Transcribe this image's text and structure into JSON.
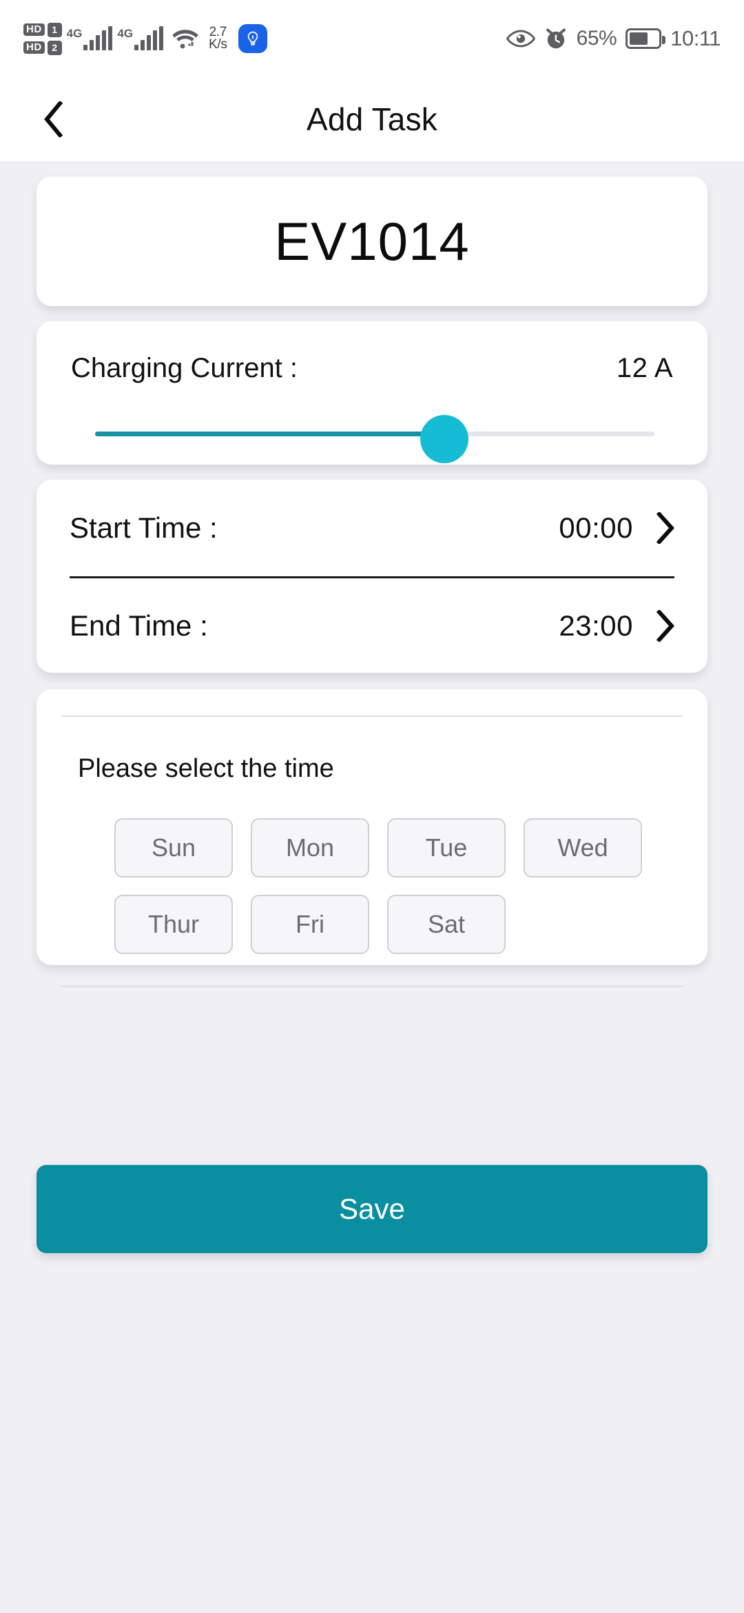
{
  "statusbar": {
    "hd1_label": "HD",
    "hd2_label": "HD",
    "sim1": "1",
    "sim2": "2",
    "net1": "4G",
    "net2": "4G",
    "speed_value": "2.7",
    "speed_unit": "K/s",
    "battery_percent": "65%",
    "clock": "10:11",
    "icons": {
      "wifi": "wifi-icon",
      "bulb_app": "lightbulb-app-icon",
      "eye": "eye-care-icon",
      "alarm": "alarm-clock-icon",
      "battery": "battery-icon"
    },
    "battery_fill_ratio": "65"
  },
  "appbar": {
    "title": "Add Task",
    "back_icon": "chevron-left-icon"
  },
  "device": {
    "name": "EV1014"
  },
  "charging": {
    "label": "Charging Current :",
    "value": "12 A",
    "slider": {
      "value": 12,
      "min": 6,
      "max": 32,
      "fill_percent": 57
    }
  },
  "times": [
    {
      "label": "Start Time :",
      "value": "00:00",
      "chevron": "chevron-right-icon"
    },
    {
      "label": "End Time :",
      "value": "23:00",
      "chevron": "chevron-right-icon"
    }
  ],
  "days": {
    "hint": "Please select the time",
    "row1": [
      "Sun",
      "Mon",
      "Tue",
      "Wed"
    ],
    "row2": [
      "Thur",
      "Fri",
      "Sat"
    ],
    "selected": []
  },
  "actions": {
    "save_label": "Save"
  },
  "colors": {
    "page_bg": "#f0eff4",
    "card_bg": "#ffffff",
    "accent_track": "#1893a6",
    "accent_thumb": "#14bdd4",
    "save_bg": "#0a8fa0",
    "chip_bg": "#f6f5f8",
    "chip_border": "#cfced5",
    "chip_text": "#6c6b73",
    "status_icon": "#5d5d62",
    "bulb_app_bg": "#1a62e8"
  }
}
